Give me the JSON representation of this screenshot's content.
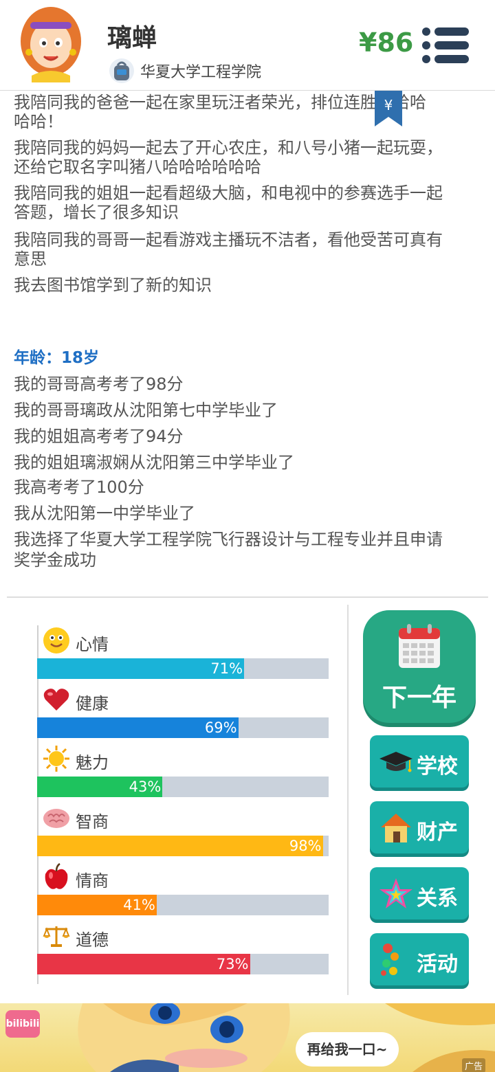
{
  "header": {
    "name": "璃蝉",
    "school": "华夏大学工程学院",
    "money": "¥86"
  },
  "log": {
    "lines_before": [
      "我陪同我的爸爸一起在家里玩汪者荣光，排位连胜哈哈哈",
      "哈哈！",
      "我陪同我的妈妈一起去了开心农庄，和八号小猪一起玩耍，",
      "还给它取名字叫猪八哈哈哈哈哈哈",
      "我陪同我的姐姐一起看超级大脑，和电视中的参赛选手一起",
      "答题，增长了很多知识",
      "我陪同我的哥哥一起看游戏主播玩不洁者，看他受苦可真有",
      "意思",
      "我去图书馆学到了新的知识"
    ],
    "age_heading": "年龄：18岁",
    "lines_after": [
      "我的哥哥高考考了98分",
      "我的哥哥璃政从沈阳第七中学毕业了",
      "我的姐姐高考考了94分",
      "我的姐姐璃淑娴从沈阳第三中学毕业了",
      "我高考考了100分",
      "我从沈阳第一中学毕业了",
      "我选择了华夏大学工程学院飞行器设计与工程专业并且申请",
      "奖学金成功"
    ],
    "bookmark_symbol": "¥"
  },
  "stats": [
    {
      "label": "心情",
      "value": 71,
      "text": "71%",
      "color": "#1ab3d8",
      "icon": "smiley-icon"
    },
    {
      "label": "健康",
      "value": 69,
      "text": "69%",
      "color": "#1683db",
      "icon": "heart-icon"
    },
    {
      "label": "魅力",
      "value": 43,
      "text": "43%",
      "color": "#1ec35e",
      "icon": "sun-icon"
    },
    {
      "label": "智商",
      "value": 98,
      "text": "98%",
      "color": "#ffb814",
      "icon": "brain-icon"
    },
    {
      "label": "情商",
      "value": 41,
      "text": "41%",
      "color": "#ff8a0a",
      "icon": "apple-icon"
    },
    {
      "label": "道德",
      "value": 73,
      "text": "73%",
      "color": "#e83546",
      "icon": "scales-icon"
    }
  ],
  "buttons": {
    "next_year": "下一年",
    "school": "学校",
    "property": "财产",
    "relations": "关系",
    "activities": "活动"
  },
  "ad": {
    "logo": "bilibili",
    "bubble": "再给我一口~",
    "tag": "广告"
  }
}
